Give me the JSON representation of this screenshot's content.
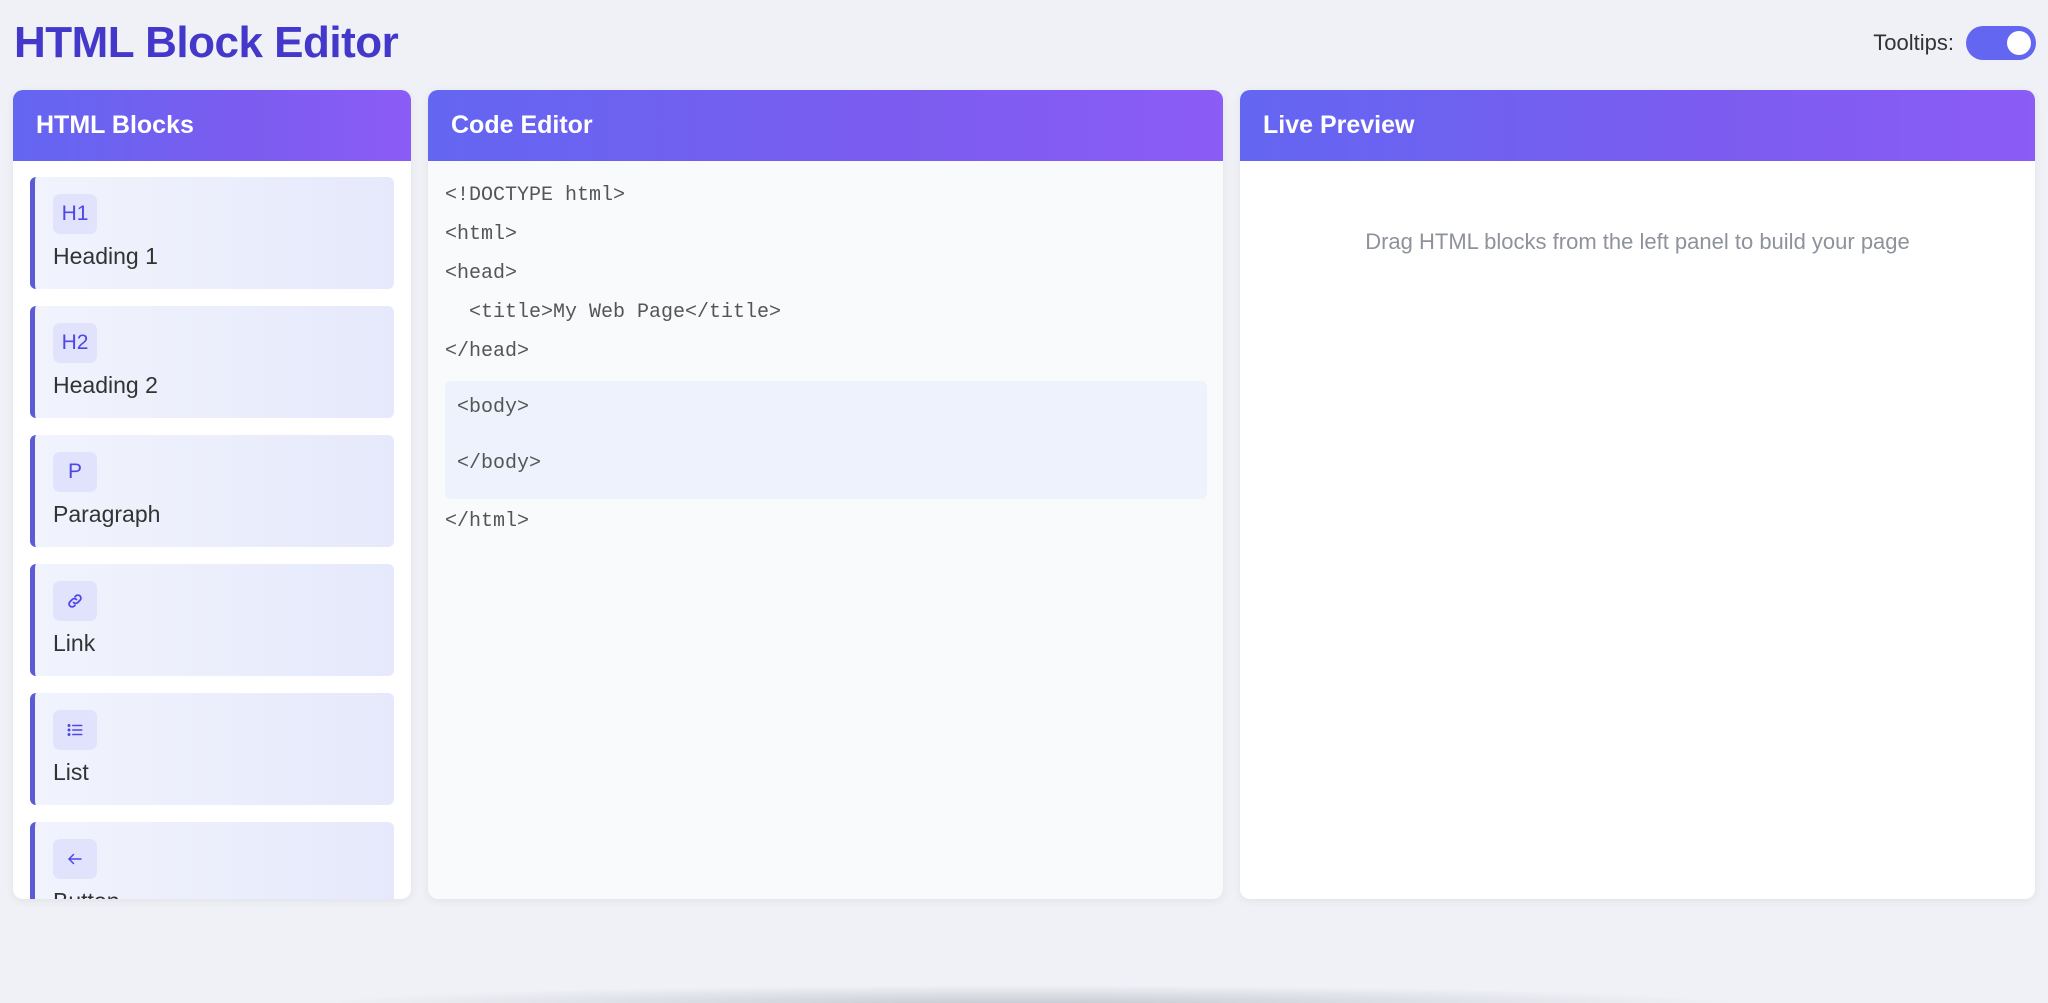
{
  "page": {
    "title": "HTML Block Editor"
  },
  "tooltips": {
    "label": "Tooltips:",
    "enabled": true
  },
  "blocks_panel": {
    "title": "HTML Blocks",
    "items": [
      {
        "icon_text": "H1",
        "label": "Heading 1"
      },
      {
        "icon_text": "H2",
        "label": "Heading 2"
      },
      {
        "icon_text": "P",
        "label": "Paragraph"
      },
      {
        "icon": "link-icon",
        "label": "Link"
      },
      {
        "icon": "list-icon",
        "label": "List"
      },
      {
        "icon": "arrow-left-icon",
        "label": "Button"
      }
    ]
  },
  "code_panel": {
    "title": "Code Editor",
    "lines_before": [
      "<!DOCTYPE html>",
      "<html>",
      "<head>",
      "  <title>My Web Page</title>",
      "</head>"
    ],
    "body_open": "<body>",
    "body_close": "</body>",
    "lines_after": [
      "</html>"
    ]
  },
  "preview_panel": {
    "title": "Live Preview",
    "hint": "Drag HTML blocks from the left panel to build your page"
  },
  "colors": {
    "accent": "#4338ca",
    "header_gradient_start": "#6366f1",
    "header_gradient_end": "#8b5cf6",
    "toggle_on": "#6366f1"
  }
}
